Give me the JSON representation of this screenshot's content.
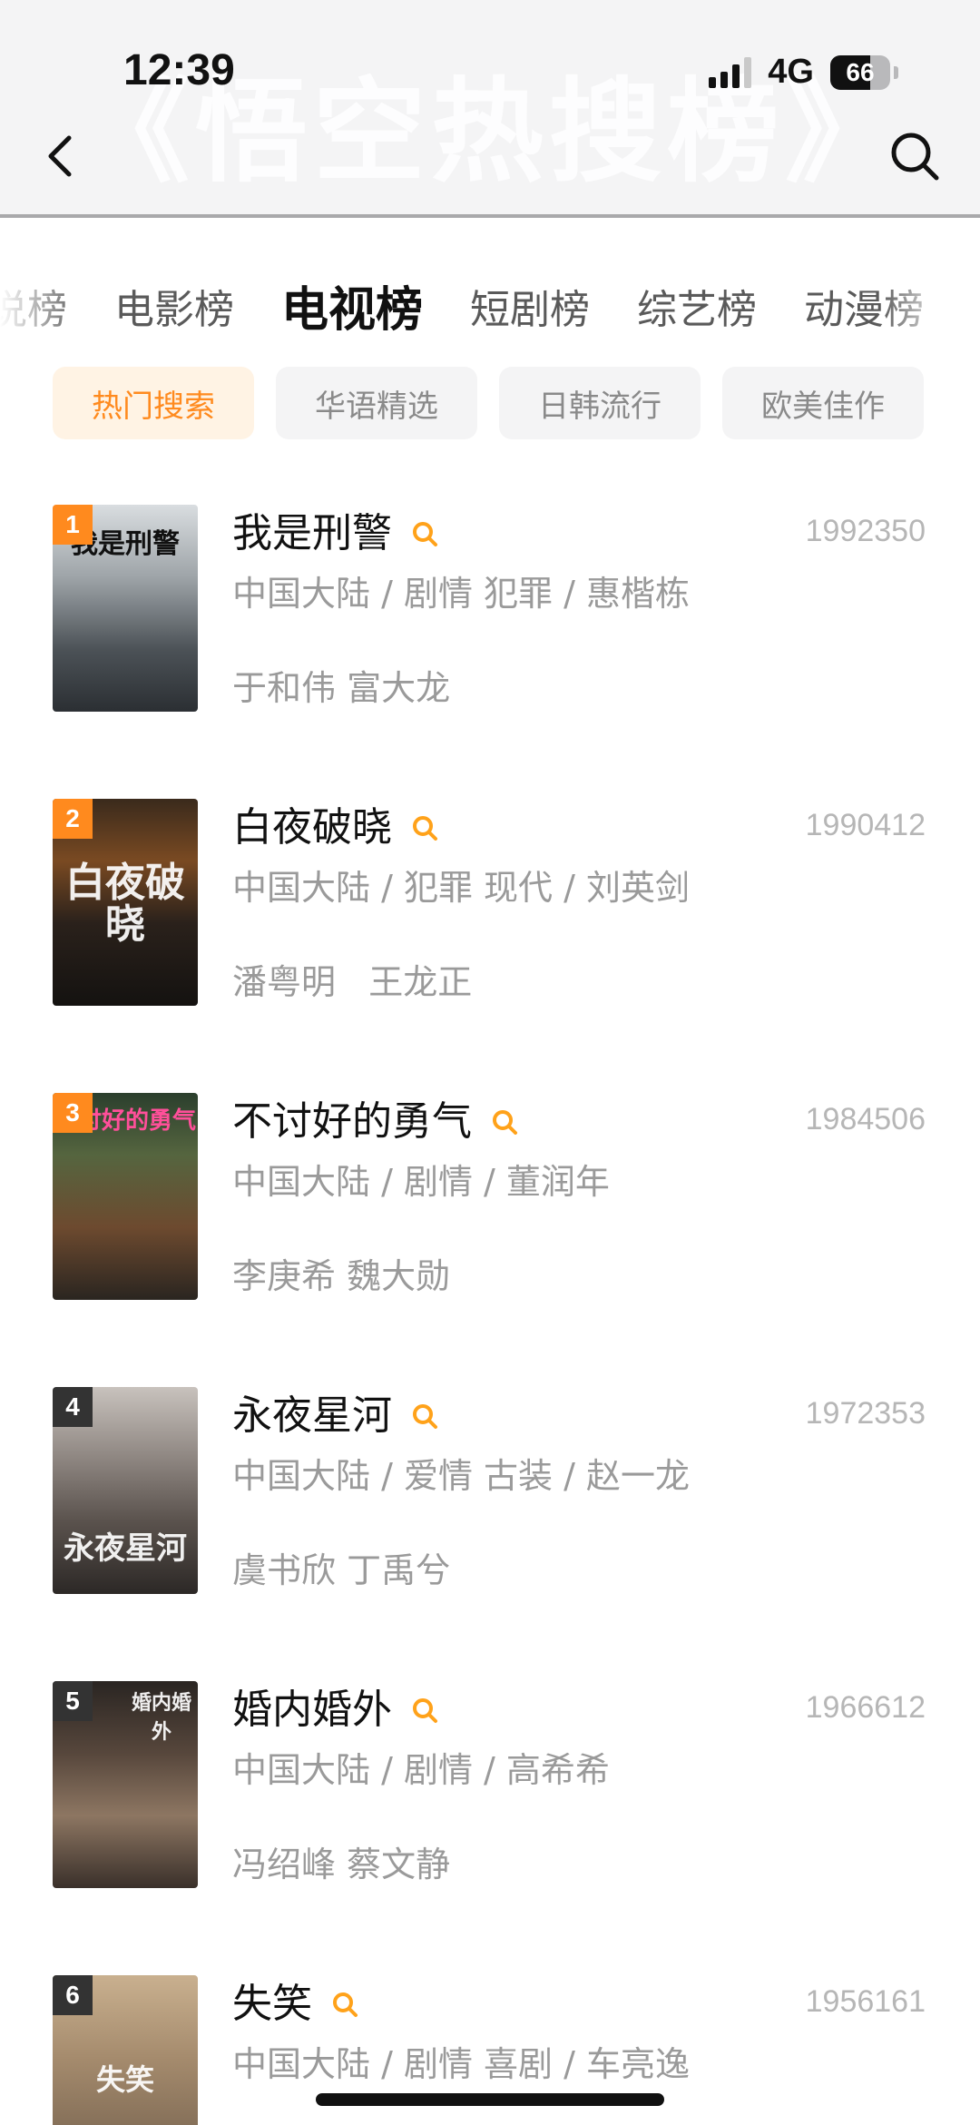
{
  "status_bar": {
    "time": "12:39",
    "network": "4G",
    "battery": "66",
    "battery_level": 0.66
  },
  "header": {
    "watermark_title": "《悟空热搜榜》"
  },
  "category_tabs": [
    {
      "label": "说榜",
      "active": false
    },
    {
      "label": "电影榜",
      "active": false
    },
    {
      "label": "电视榜",
      "active": true
    },
    {
      "label": "短剧榜",
      "active": false
    },
    {
      "label": "综艺榜",
      "active": false
    },
    {
      "label": "动漫榜",
      "active": false
    }
  ],
  "sub_tabs": [
    {
      "label": "热门搜索",
      "active": true
    },
    {
      "label": "华语精选",
      "active": false
    },
    {
      "label": "日韩流行",
      "active": false
    },
    {
      "label": "欧美佳作",
      "active": false
    }
  ],
  "colors": {
    "accent": "#ff8a1e",
    "rank_badge": "#ff8a1e",
    "rank_badge_dark": "#333333"
  },
  "items": [
    {
      "rank": "1",
      "title": "我是刑警",
      "score": "1992350",
      "meta": "中国大陆 / 剧情 犯罪 / 惠楷栋",
      "cast": "于和伟 富大龙",
      "poster_text": "我是刑警"
    },
    {
      "rank": "2",
      "title": "白夜破晓",
      "score": "1990412",
      "meta": "中国大陆 / 犯罪 现代 / 刘英剑",
      "cast": "潘粤明   王龙正",
      "poster_text": "白夜破晓"
    },
    {
      "rank": "3",
      "title": "不讨好的勇气",
      "score": "1984506",
      "meta": "中国大陆 / 剧情 / 董润年",
      "cast": "李庚希 魏大勋",
      "poster_text": "不讨好的勇气"
    },
    {
      "rank": "4",
      "title": "永夜星河",
      "score": "1972353",
      "meta": "中国大陆 / 爱情 古装 / 赵一龙",
      "cast": "虞书欣 丁禹兮",
      "poster_text": "永夜星河"
    },
    {
      "rank": "5",
      "title": "婚内婚外",
      "score": "1966612",
      "meta": "中国大陆 / 剧情 / 高希希",
      "cast": "冯绍峰 蔡文静",
      "poster_text": "婚内婚外"
    },
    {
      "rank": "6",
      "title": "失笑",
      "score": "1956161",
      "meta": "中国大陆 / 剧情 喜剧 / 车亮逸",
      "cast": "",
      "poster_text": "失笑"
    }
  ]
}
